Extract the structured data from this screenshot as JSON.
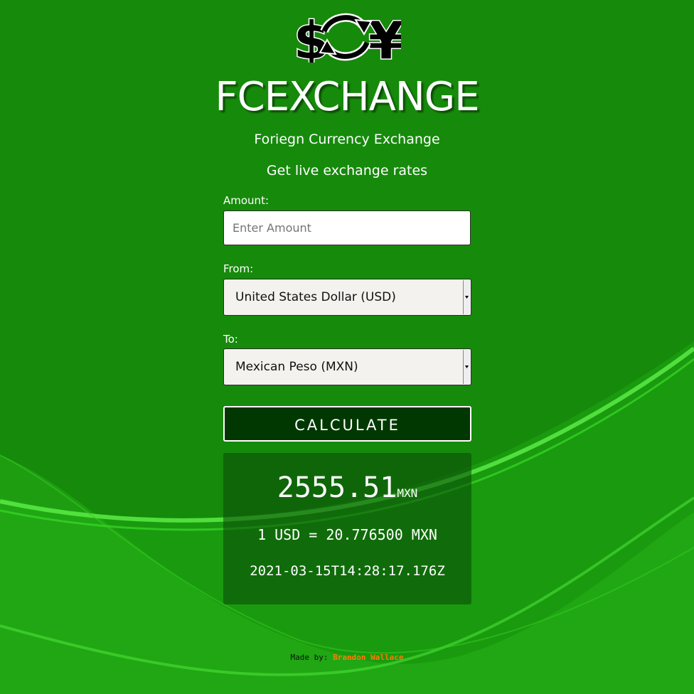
{
  "app": {
    "title": "FCEXCHANGE",
    "subtitle": "Foriegn Currency Exchange",
    "tagline": "Get live exchange rates",
    "logo_icon": "currency-exchange-icon"
  },
  "form": {
    "amount_label": "Amount:",
    "amount_placeholder": "Enter Amount",
    "amount_value": "",
    "from_label": "From:",
    "from_selected": "United States Dollar (USD)",
    "to_label": "To:",
    "to_selected": "Mexican Peso (MXN)",
    "calculate_label": "CALCULATE"
  },
  "result": {
    "value": "2555.51",
    "unit": "MXN",
    "rate_text": "1 USD = 20.776500 MXN",
    "timestamp": "2021-03-15T14:28:17.176Z"
  },
  "footer": {
    "made_by_label": "Made by:",
    "author": "Brandon Wallace"
  },
  "colors": {
    "background": "#168a0b",
    "button": "#013801",
    "author": "#ff7a00"
  }
}
